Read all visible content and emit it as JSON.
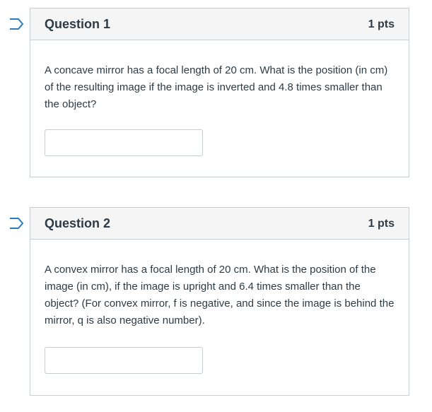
{
  "questions": [
    {
      "title": "Question 1",
      "points": "1 pts",
      "text": "A concave mirror has a focal length of 20 cm. What is the position (in cm) of the resulting image if the image is inverted and 4.8 times smaller than the object?",
      "answer_value": ""
    },
    {
      "title": "Question 2",
      "points": "1 pts",
      "text": "A convex mirror has a focal length of 20 cm. What is the position of the image (in cm), if the image is upright and 6.4 times smaller than the object? (For convex mirror, f is negative, and since the image is behind the mirror, q is also negative number).",
      "answer_value": ""
    }
  ],
  "colors": {
    "flag": "#2b7abc",
    "border": "#c7cdd1",
    "header_bg": "#f5f5f5",
    "text": "#2d3b45"
  },
  "icons": {
    "flag": "flag-question-icon"
  }
}
